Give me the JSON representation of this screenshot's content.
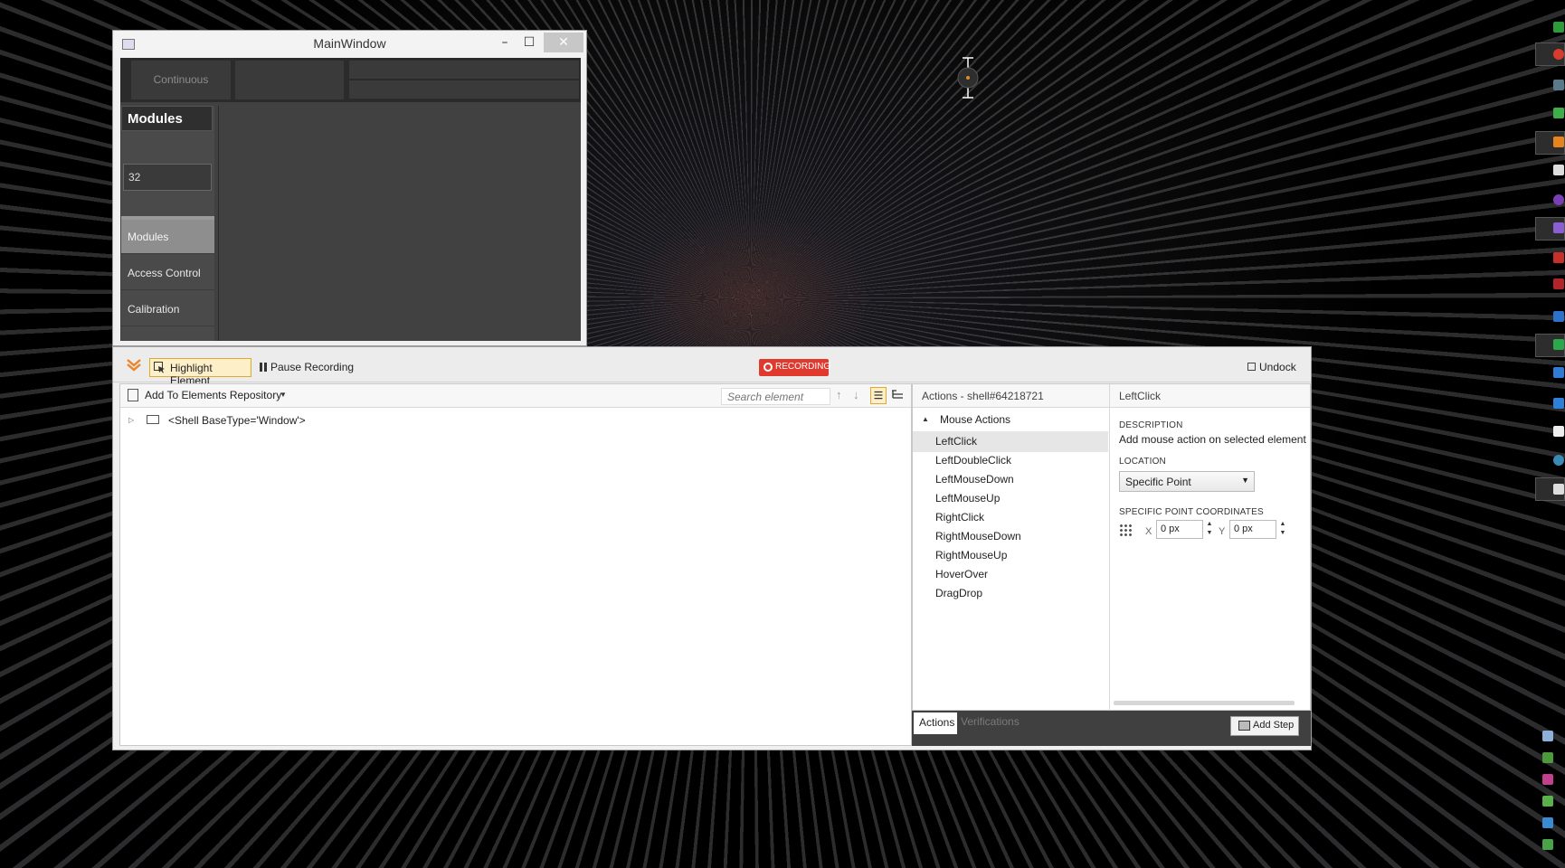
{
  "main_window": {
    "title": "MainWindow",
    "controls": {
      "minimize": "–",
      "maximize": "☐",
      "close": "✕"
    },
    "tabs": [
      "Continuous"
    ],
    "sidebar": {
      "header": "Modules",
      "field_value": "32",
      "items": [
        "Modules",
        "Access Control",
        "Calibration"
      ]
    }
  },
  "recorder": {
    "toolbar": {
      "highlight_label": "Highlight Element",
      "pause_label": "Pause Recording",
      "recording_label": "RECORDING",
      "undock_label": "Undock"
    },
    "tree": {
      "add_repo_label": "Add To Elements Repository",
      "search_placeholder": "Search element",
      "root_node": "<Shell BaseType='Window'>"
    },
    "actions": {
      "header": "Actions - shell#64218721",
      "group": "Mouse Actions",
      "items": [
        "LeftClick",
        "LeftDoubleClick",
        "LeftMouseDown",
        "LeftMouseUp",
        "RightClick",
        "RightMouseDown",
        "RightMouseUp",
        "HoverOver",
        "DragDrop"
      ],
      "selected": "LeftClick"
    },
    "details": {
      "title": "LeftClick",
      "description_label": "DESCRIPTION",
      "description_text": "Add mouse action on selected element",
      "location_label": "LOCATION",
      "location_value": "Specific Point",
      "coords_label": "SPECIFIC POINT COORDINATES",
      "x_label": "X",
      "x_value": "0 px",
      "y_label": "Y",
      "y_value": "0 px"
    },
    "bottom": {
      "tab_actions": "Actions",
      "tab_verifications": "Verifications",
      "add_step_label": "Add Step"
    }
  },
  "colors": {
    "recording_red": "#e03a2e",
    "highlight_orange": "#e0a930",
    "dark_panel": "#414141"
  },
  "taskbar_icons": [
    "app-icon-green",
    "browser-icon",
    "app-icon",
    "app-icon-green",
    "app-icon-orange",
    "app-icon",
    "app-icon-purple",
    "visual-studio-icon",
    "app-icon-red",
    "app-icon-red",
    "app-icon-blue",
    "app-icon-green",
    "app-icon-blue",
    "app-icon-blue",
    "app-icon-white",
    "app-icon-blue",
    "app-icon-white",
    "tray-icon",
    "tray-icon",
    "tray-icon",
    "tray-icon",
    "tray-icon",
    "tray-icon"
  ]
}
